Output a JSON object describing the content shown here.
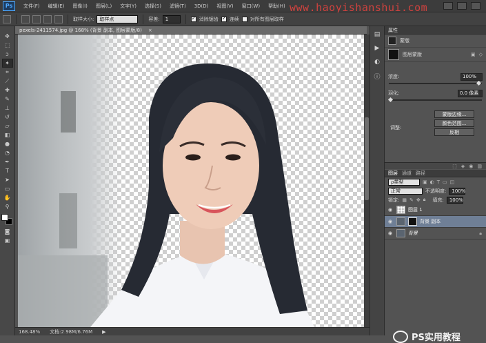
{
  "app": {
    "logo": "Ps"
  },
  "menubar": {
    "items": [
      "文件(F)",
      "编辑(E)",
      "图像(I)",
      "图层(L)",
      "文字(Y)",
      "选择(S)",
      "滤镜(T)",
      "3D(D)",
      "视图(V)",
      "窗口(W)",
      "帮助(H)"
    ],
    "watermark": "www.haoyishanshui.com"
  },
  "optionsbar": {
    "sample_size_label": "取样大小:",
    "sample_size_value": "取样点",
    "tolerance_label": "容差:",
    "tolerance_value": "1",
    "antialias_label": "消除锯齿",
    "contiguous_label": "连续",
    "all_layers_label": "对所有图层取样"
  },
  "document": {
    "tab_label": "pexels-2411574.jpg @ 168% (背景 副本, 图层蒙版/8)",
    "close_label": "×"
  },
  "status": {
    "zoom": "168.48%",
    "doc": "文档:2.98M/6.76M",
    "arrow": "▶"
  },
  "properties": {
    "header": "属性",
    "mask_label": "蒙版",
    "layer_mask_label": "图层蒙版",
    "density_label": "浓度:",
    "density_value": "100%",
    "feather_label": "羽化:",
    "feather_value": "0.0 像素",
    "refine_label": "调整:",
    "mask_edge_btn": "蒙版边缘...",
    "color_range_btn": "颜色范围...",
    "invert_btn": "反相"
  },
  "layers": {
    "tabs": [
      "图层",
      "通道",
      "路径"
    ],
    "kind_label": "ρ类型",
    "blend_mode": "正常",
    "opacity_label": "不透明度:",
    "opacity_value": "100%",
    "lock_label": "锁定:",
    "fill_label": "填充:",
    "fill_value": "100%",
    "rows": [
      {
        "name": "图层 1"
      },
      {
        "name": "背景 副本"
      },
      {
        "name": "背景"
      }
    ]
  },
  "badge": {
    "text": "PS实用教程"
  },
  "colors": {
    "accent": "#e0433f",
    "selected_layer": "#6f7f96"
  }
}
